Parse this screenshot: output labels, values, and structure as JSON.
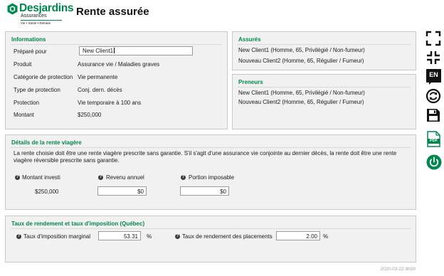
{
  "brand": {
    "name": "Desjardins",
    "sub": "Assurances",
    "tagline": "Vie • Santé • Retraite"
  },
  "page_title": "Rente assurée",
  "informations": {
    "title": "Informations",
    "rows": [
      {
        "label": "Préparé pour",
        "value": "New Client1"
      },
      {
        "label": "Produit",
        "value": "Assurance vie / Maladies graves"
      },
      {
        "label": "Catégorie de protection",
        "value": "Vie permanente"
      },
      {
        "label": "Type de protection",
        "value": "Conj. dern. décès"
      },
      {
        "label": "Protection",
        "value": "Vie temporaire à 100 ans"
      },
      {
        "label": "Montant",
        "value": "$250,000"
      }
    ]
  },
  "assures": {
    "title": "Assurés",
    "items": [
      "New Client1 (Homme, 65, Privilégié / Non-fumeur)",
      "Nouveau Client2 (Homme, 65, Régulier / Fumeur)"
    ]
  },
  "preneurs": {
    "title": "Preneurs",
    "items": [
      "New Client1 (Homme, 65, Privilégié / Non-fumeur)",
      "Nouveau Client2 (Homme, 65, Régulier / Fumeur)"
    ]
  },
  "rente": {
    "title": "Détails de la rente viagère",
    "description": "La rente choisie doit être une rente viagère prescrite sans garantie. S'il s'agit d'une assurance vie conjointe au dernier décès, la rente doit être une rente viagère réversible prescrite sans garantie.",
    "montant_label": "Montant investi",
    "montant_value": "$250,000",
    "revenu_label": "Revenu annuel",
    "revenu_value": "$0",
    "portion_label": "Portion imposable",
    "portion_value": "$0"
  },
  "taux": {
    "title": "Taux de rendement et taux d'imposition (Québec)",
    "imposition_label": "Taux d'imposition marginal",
    "imposition_value": "53.31",
    "rendement_label": "Taux de rendement des placements",
    "rendement_value": "2.00",
    "percent": "%"
  },
  "toolbar": {
    "fullscreen": "expand-icon",
    "collapse": "collapse-icon",
    "language": "EN",
    "refresh": "refresh-icon",
    "save": "save-icon",
    "pdf": "PDF",
    "power": "power-icon"
  },
  "timestamp": "2020-03-22 9h00",
  "colors": {
    "accent": "#00874e",
    "panel_bg": "#f1f1f1",
    "dark_icon": "#111111"
  }
}
